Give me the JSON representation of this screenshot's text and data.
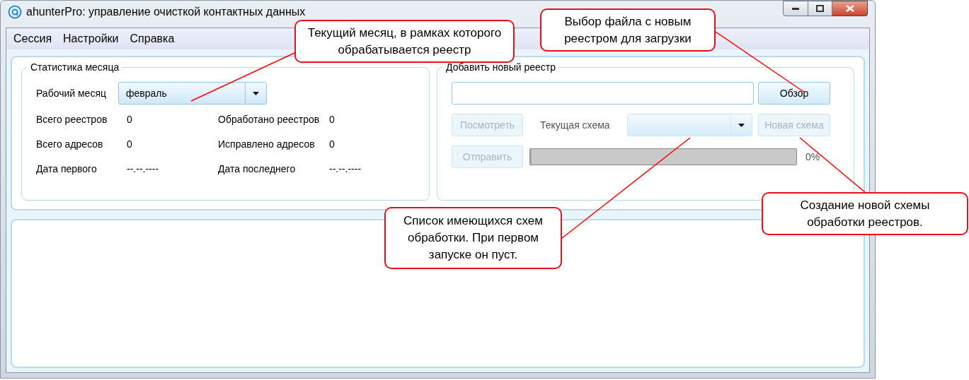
{
  "window": {
    "title": "ahunterPro: управление очисткой контактных данных"
  },
  "menu": [
    {
      "label": "Сессия"
    },
    {
      "label": "Настройки"
    },
    {
      "label": "Справка"
    }
  ],
  "month_stats": {
    "title": "Статистика месяца",
    "month_label": "Рабочий месяц",
    "month_value": "февраль",
    "stats": [
      {
        "label": "Всего реестров",
        "value": "0"
      },
      {
        "label": "Обработано реестров",
        "value": "0"
      },
      {
        "label": "Всего адресов",
        "value": "0"
      },
      {
        "label": "Исправлено адресов",
        "value": "0"
      },
      {
        "label": "Дата первого",
        "value": "--.--.----"
      },
      {
        "label": "Дата последнего",
        "value": "--.--.----"
      }
    ]
  },
  "add_registry": {
    "title": "Добавить новый реестр",
    "browse_button": {
      "label": "Обзор",
      "disabled": false
    },
    "view_button": {
      "label": "Посмотреть",
      "disabled": true
    },
    "scheme_label": "Текущая схема",
    "new_scheme_button": {
      "label": "Новая схема",
      "disabled": true
    },
    "send_button": {
      "label": "Отправить",
      "disabled": true
    },
    "progress": {
      "level": 0,
      "reading": "0%"
    }
  },
  "callouts": [
    {
      "text": "Текущий месяц, в рамках которого обрабатывается реестр"
    },
    {
      "text": "Выбор файла с новым реестром для загрузки"
    },
    {
      "text": "Список имеющихся схем обработки. При первом запуске он пуст."
    },
    {
      "text": "Создание новой схемы обработки реестров."
    }
  ]
}
